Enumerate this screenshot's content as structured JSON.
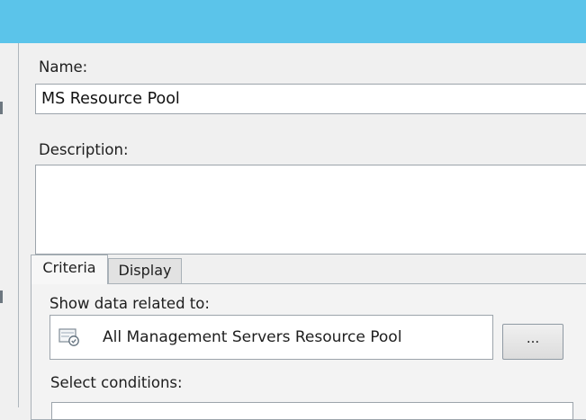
{
  "form": {
    "name_label": "Name:",
    "name_value": "MS Resource Pool",
    "description_label": "Description:",
    "description_value": ""
  },
  "tabs": [
    {
      "label": "Criteria",
      "active": true
    },
    {
      "label": "Display",
      "active": false
    }
  ],
  "criteria": {
    "show_data_label": "Show data related to:",
    "target_value": "All Management Servers Resource Pool",
    "target_icon": "resource-pool-icon",
    "browse_label": "...",
    "select_conditions_label": "Select conditions:"
  },
  "colors": {
    "titlebar": "#5bc4ea",
    "window_background": "#f0f0f0",
    "border": "#9ca4ab"
  }
}
